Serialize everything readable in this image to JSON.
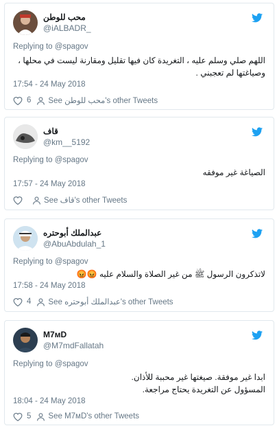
{
  "colors": {
    "brand": "#1da1f2",
    "muted": "#657786",
    "border": "#e1e8ed"
  },
  "icons": {
    "brand": "twitter-bird-icon",
    "like": "heart-icon",
    "profile": "person-icon"
  },
  "tweets": [
    {
      "display_name": "محب للوطن",
      "handle": "@iALBADR_",
      "replying_to": "Replying to @spagov",
      "text": "اللهم صلي وسلم عليه ، التغريدة كان فيها تقليل ومقارنة ليست في محلها ، وصياغتها لم تعجبني .",
      "time": "17:54 - 24 May 2018",
      "likes": "6",
      "other_tweets": "See محب للوطن's other Tweets"
    },
    {
      "display_name": "قاف",
      "handle": "@km__5192",
      "replying_to": "Replying to @spagov",
      "text": "الصياغة غير موفقه",
      "time": "17:57 - 24 May 2018",
      "likes": "",
      "other_tweets": "See قاف's other Tweets"
    },
    {
      "display_name": "عبدالملك أبوحتره",
      "handle": "@AbuAbdulah_1",
      "replying_to": "Replying to @spagov",
      "text": "لاتذكرون الرسول ﷺ من غير الصلاة والسلام عليه 😡😡",
      "time": "17:58 - 24 May 2018",
      "likes": "4",
      "other_tweets": "See عبدالملك أبوحتره's other Tweets"
    },
    {
      "display_name": "M7ᴍD",
      "handle": "@M7mdFallatah",
      "replying_to": "Replying to @spagov",
      "text_lines": [
        "ابدا غير موفقة. صيغتها غير محببة للأذان.",
        "المسؤول عن التغريدة يحتاج مراجعة."
      ],
      "time": "18:04 - 24 May 2018",
      "likes": "5",
      "other_tweets": "See M7ᴍD's other Tweets"
    }
  ]
}
